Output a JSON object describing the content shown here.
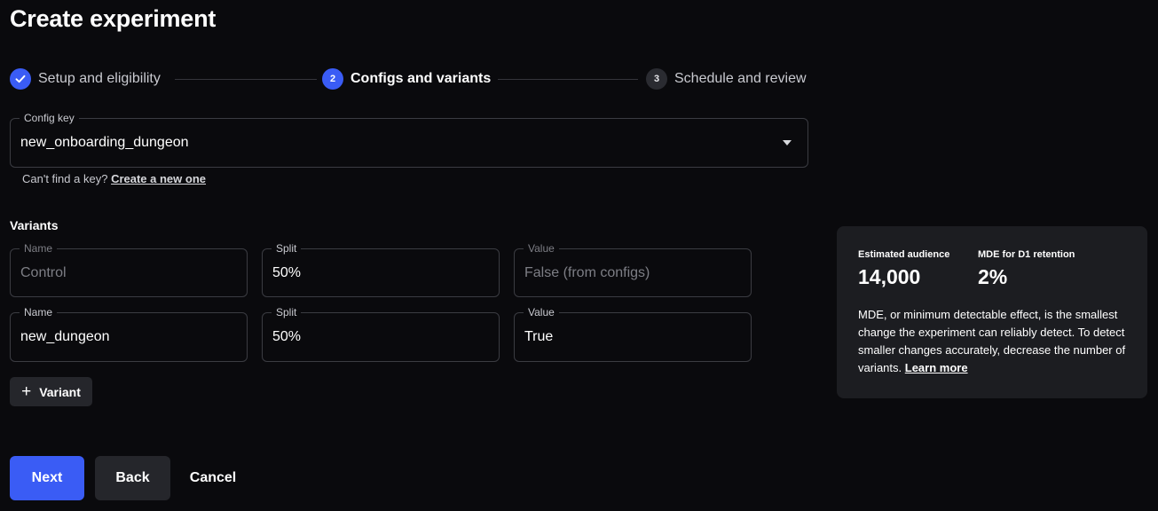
{
  "page": {
    "title": "Create experiment"
  },
  "stepper": {
    "steps": [
      {
        "number": "✓",
        "label": "Setup and eligibility",
        "state": "done"
      },
      {
        "number": "2",
        "label": "Configs and variants",
        "state": "active"
      },
      {
        "number": "3",
        "label": "Schedule and review",
        "state": "pending"
      }
    ]
  },
  "config_key": {
    "label": "Config key",
    "value": "new_onboarding_dungeon",
    "helper_text": "Can't find a key?",
    "helper_link": "Create a new one"
  },
  "variants": {
    "heading": "Variants",
    "rows": [
      {
        "name_label": "Name",
        "name_value": "Control",
        "split_label": "Split",
        "split_value": "50%",
        "value_label": "Value",
        "value_value": "False (from configs)"
      },
      {
        "name_label": "Name",
        "name_value": "new_dungeon",
        "split_label": "Split",
        "split_value": "50%",
        "value_label": "Value",
        "value_value": "True"
      }
    ],
    "add_button_label": "Variant"
  },
  "info_card": {
    "audience_label": "Estimated audience",
    "audience_value": "14,000",
    "mde_label": "MDE for D1 retention",
    "mde_value": "2%",
    "description": "MDE, or minimum detectable effect, is the smallest change the experiment can reliably detect. To detect smaller changes accurately, decrease the number of variants.",
    "learn_more": "Learn more"
  },
  "footer": {
    "next_label": "Next",
    "back_label": "Back",
    "cancel_label": "Cancel"
  },
  "colors": {
    "background": "#0a0a0d",
    "accent": "#3a5cf5",
    "card": "#1c1d21",
    "border": "#3b3c42"
  }
}
